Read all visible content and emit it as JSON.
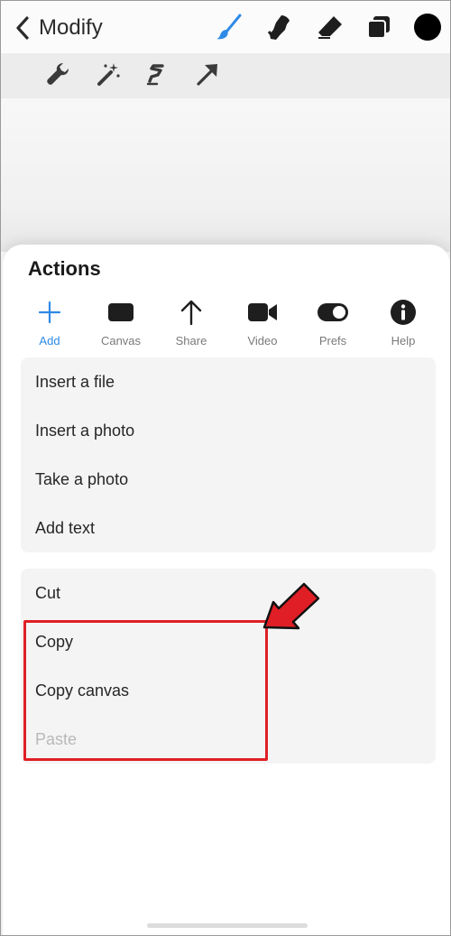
{
  "header": {
    "back_label": "Modify",
    "tools": [
      {
        "icon": "brush-icon",
        "color": "#2e8ae6"
      },
      {
        "icon": "smudge-icon"
      },
      {
        "icon": "eraser-icon"
      },
      {
        "icon": "layers-icon"
      },
      {
        "icon": "color-swatch-icon",
        "color": "#000000"
      }
    ]
  },
  "toolbar2": {
    "tools": [
      "wrench-icon",
      "magic-wand-icon",
      "selection-icon",
      "transform-arrow-icon"
    ]
  },
  "actions": {
    "title": "Actions",
    "tabs": [
      {
        "label": "Add",
        "icon": "plus-icon",
        "active": true
      },
      {
        "label": "Canvas",
        "icon": "canvas-icon"
      },
      {
        "label": "Share",
        "icon": "share-arrow-icon"
      },
      {
        "label": "Video",
        "icon": "video-camera-icon"
      },
      {
        "label": "Prefs",
        "icon": "toggle-icon"
      },
      {
        "label": "Help",
        "icon": "info-icon"
      }
    ],
    "group1": [
      "Insert a file",
      "Insert a photo",
      "Take a photo",
      "Add text"
    ],
    "group2": [
      "Cut",
      "Copy",
      "Copy canvas",
      "Paste"
    ],
    "disabled_items": [
      "Paste"
    ]
  },
  "annotation": {
    "color": "#e01e25"
  }
}
